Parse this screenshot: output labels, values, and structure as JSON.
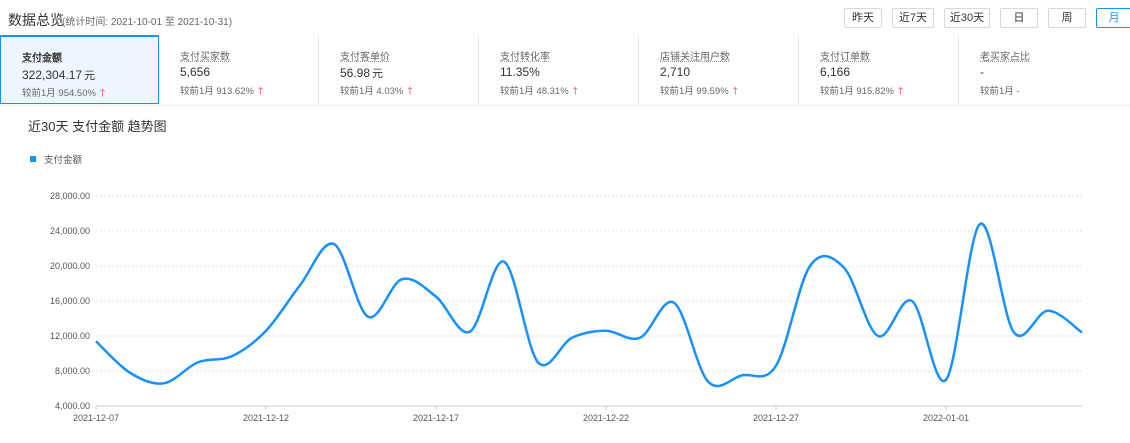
{
  "header": {
    "title": "数据总览",
    "range": "(统计时间: 2021-10-01 至 2021-10-31)",
    "buttons": [
      "昨天",
      "近7天",
      "近30天",
      "日",
      "周",
      "月"
    ],
    "active_button": "月"
  },
  "metrics": [
    {
      "label": "支付金额",
      "value": "322,304.17",
      "unit": "元",
      "change": "较前1月  954.50%",
      "trend": "up"
    },
    {
      "label": "支付买家数",
      "value": "5,656",
      "unit": "",
      "change": "较前1月  913.62%",
      "trend": "up"
    },
    {
      "label": "支付客单价",
      "value": "56.98",
      "unit": "元",
      "change": "较前1月  4.03%",
      "trend": "up"
    },
    {
      "label": "支付转化率",
      "value": "11.35%",
      "unit": "",
      "change": "较前1月  48.31%",
      "trend": "up"
    },
    {
      "label": "店铺关注用户数",
      "value": "2,710",
      "unit": "",
      "change": "较前1月  99.59%",
      "trend": "up"
    },
    {
      "label": "支付订单数",
      "value": "6,166",
      "unit": "",
      "change": "较前1月  915.82%",
      "trend": "up"
    },
    {
      "label": "老买家占比",
      "value": "-",
      "unit": "",
      "change": "较前1月  -",
      "trend": "none"
    }
  ],
  "colors": {
    "accent": "#1890ff",
    "up_arrow": "#e8302f"
  },
  "chart_data": {
    "type": "line",
    "title": "近30天 支付金额 趋势图",
    "legend": "top-left",
    "grid": true,
    "ylim": [
      4000,
      28000
    ],
    "yticks": [
      "4,000.00",
      "8,000.00",
      "12,000.00",
      "16,000.00",
      "20,000.00",
      "24,000.00",
      "28,000.00"
    ],
    "ytick_values": [
      4000,
      8000,
      12000,
      16000,
      20000,
      24000,
      28000
    ],
    "xticks": [
      "2021-12-07",
      "2021-12-12",
      "2021-12-17",
      "2021-12-22",
      "2021-12-27",
      "2022-01-01"
    ],
    "x": [
      "2021-12-07",
      "2021-12-08",
      "2021-12-09",
      "2021-12-10",
      "2021-12-11",
      "2021-12-12",
      "2021-12-13",
      "2021-12-14",
      "2021-12-15",
      "2021-12-16",
      "2021-12-17",
      "2021-12-18",
      "2021-12-19",
      "2021-12-20",
      "2021-12-21",
      "2021-12-22",
      "2021-12-23",
      "2021-12-24",
      "2021-12-25",
      "2021-12-26",
      "2021-12-27",
      "2021-12-28",
      "2021-12-29",
      "2021-12-30",
      "2021-12-31",
      "2022-01-01",
      "2022-01-02",
      "2022-01-03",
      "2022-01-04",
      "2022-01-05"
    ],
    "series": [
      {
        "name": "支付金额",
        "values": [
          11400,
          7800,
          6600,
          9000,
          9700,
          12600,
          17800,
          22500,
          14200,
          18500,
          16500,
          12500,
          20500,
          9000,
          11800,
          12600,
          11800,
          15800,
          6800,
          7500,
          8600,
          20000,
          19800,
          12000,
          16000,
          7000,
          24800,
          12400,
          14900,
          12400
        ]
      }
    ]
  }
}
